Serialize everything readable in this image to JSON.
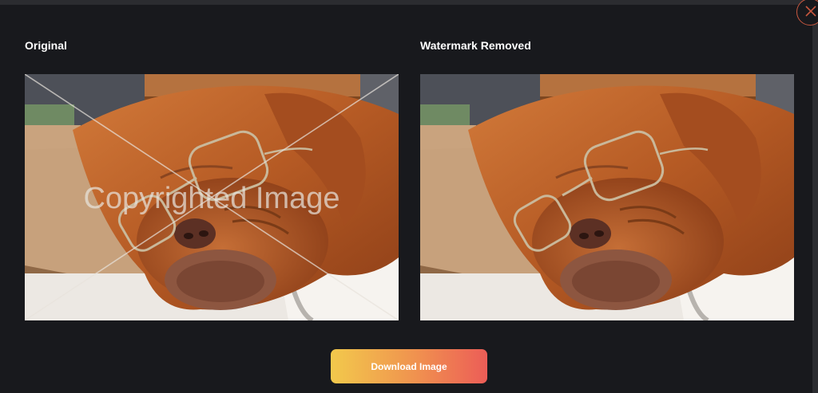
{
  "panels": {
    "original": {
      "title": "Original",
      "watermark_text": "Copyrighted Image"
    },
    "result": {
      "title": "Watermark Removed"
    }
  },
  "actions": {
    "download_label": "Download Image",
    "close_icon": "close-icon"
  },
  "colors": {
    "background": "#18191d",
    "close_accent": "#c8573f",
    "button_gradient": [
      "#f2c94c",
      "#f0914f",
      "#ec5d57"
    ]
  }
}
